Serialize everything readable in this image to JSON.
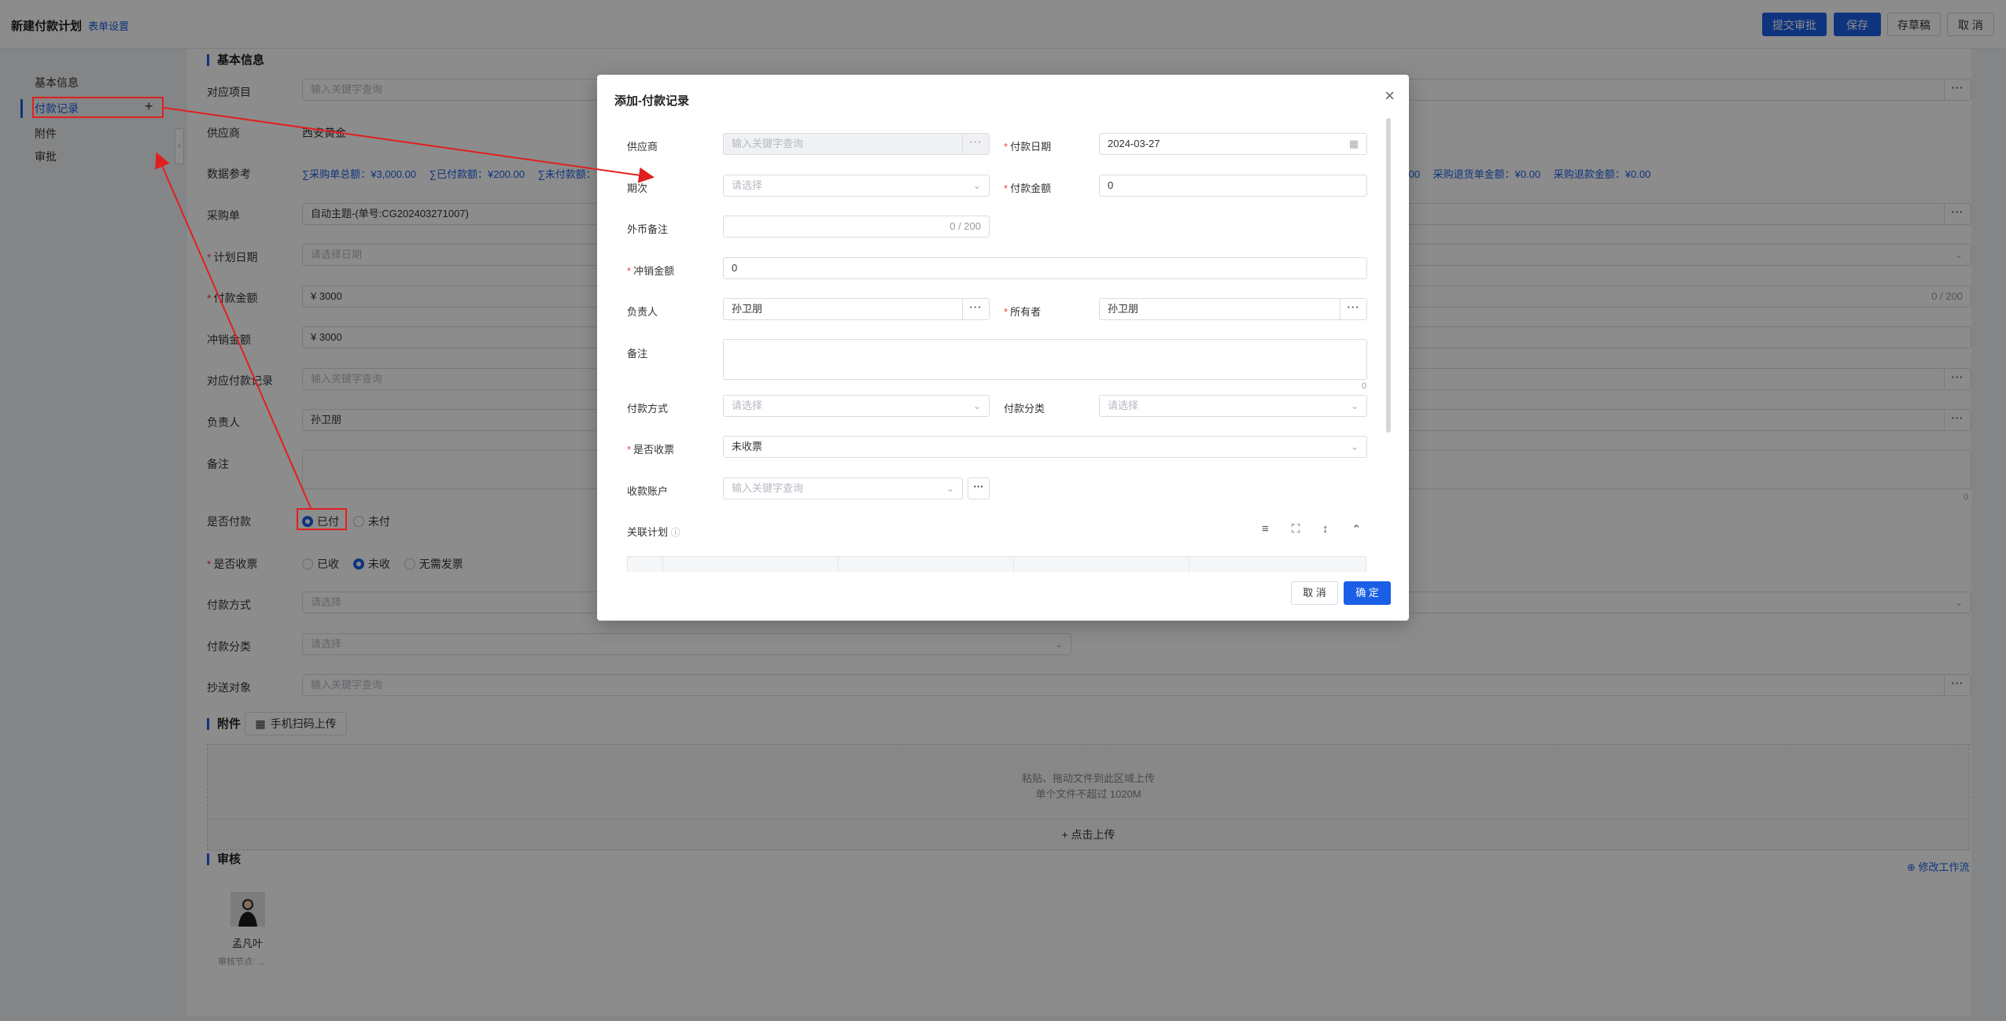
{
  "header": {
    "title": "新建付款计划",
    "form_settings": "表单设置",
    "buttons": {
      "submit": "提交审批",
      "save": "保存",
      "draft": "存草稿",
      "cancel": "取 消"
    }
  },
  "sidebar": {
    "items": [
      {
        "label": "基本信息"
      },
      {
        "label": "付款记录",
        "add_icon": "plus-icon"
      },
      {
        "label": "附件"
      },
      {
        "label": "审批"
      }
    ]
  },
  "form": {
    "section_basic": "基本信息",
    "project": {
      "label": "对应项目",
      "placeholder": "输入关键字查询"
    },
    "supplier": {
      "label": "供应商",
      "value": "西安黄金"
    },
    "data_ref": {
      "label": "数据参考",
      "left": "∑采购单总额：¥3,000.00　 ∑已付款额：¥200.00　 ∑未付款额：",
      "right": ".00　 采购退货单金额：¥0.00　 采购退款金额：¥0.00"
    },
    "purchase_order": {
      "label": "采购单",
      "value": "自动主题-(单号:CG202403271007)"
    },
    "plan_date": {
      "label": "计划日期",
      "placeholder": "请选择日期"
    },
    "pay_amount": {
      "label": "付款金额",
      "value": "¥ 3000",
      "counter": "0 / 200"
    },
    "offset_amount": {
      "label": "冲销金额",
      "value": "¥ 3000"
    },
    "pay_record": {
      "label": "对应付款记录",
      "placeholder": "输入关键字查询"
    },
    "owner": {
      "label": "负责人",
      "value": "孙卫朋"
    },
    "remark": {
      "label": "备注",
      "counter": "0"
    },
    "is_paid": {
      "label": "是否付款",
      "options": [
        "已付",
        "未付"
      ],
      "selected": "已付"
    },
    "invoice": {
      "label": "是否收票",
      "options": [
        "已收",
        "未收",
        "无需发票"
      ],
      "selected": "未收"
    },
    "pay_method": {
      "label": "付款方式",
      "placeholder": "请选择"
    },
    "pay_category": {
      "label": "付款分类",
      "placeholder": "请选择"
    },
    "cc": {
      "label": "抄送对象",
      "placeholder": "输入关键字查询"
    },
    "section_attach": "附件",
    "scan_upload": "手机扫码上传",
    "upload_hint1": "粘贴、拖动文件到此区域上传",
    "upload_hint2": "单个文件不超过 1020M",
    "upload_btn": "点击上传",
    "section_approve": "审核",
    "modify_flow": "修改工作流",
    "approver_name": "孟凡叶",
    "approver_node": "审核节点: ..."
  },
  "modal": {
    "title": "添加-付款记录",
    "supplier": {
      "label": "供应商",
      "placeholder": "输入关键字查询"
    },
    "pay_date": {
      "label": "付款日期",
      "value": "2024-03-27"
    },
    "period": {
      "label": "期次",
      "placeholder": "请选择"
    },
    "pay_amount": {
      "label": "付款金额",
      "value": "0"
    },
    "fx_remark": {
      "label": "外币备注",
      "counter": "0 / 200"
    },
    "offset_amount": {
      "label": "冲销金额",
      "value": "0"
    },
    "owner": {
      "label": "负责人",
      "value": "孙卫朋"
    },
    "holder": {
      "label": "所有者",
      "value": "孙卫朋"
    },
    "remark": {
      "label": "备注",
      "counter": "0"
    },
    "pay_method": {
      "label": "付款方式",
      "placeholder": "请选择"
    },
    "pay_category": {
      "label": "付款分类",
      "placeholder": "请选择"
    },
    "invoice": {
      "label": "是否收票",
      "value": "未收票"
    },
    "account": {
      "label": "收款账户",
      "placeholder": "输入关键字查询"
    },
    "related_plan": {
      "label": "关联计划"
    },
    "cancel": "取 消",
    "confirm": "确 定"
  },
  "colors": {
    "accent": "#1a5fe6",
    "required": "#e54545",
    "annotation": "#e02020"
  }
}
